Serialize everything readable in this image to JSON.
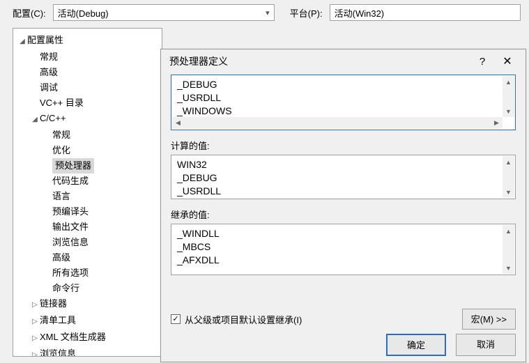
{
  "toolbar": {
    "config_label": "配置(C):",
    "config_value": "活动(Debug)",
    "platform_label": "平台(P):",
    "platform_value": "活动(Win32)"
  },
  "tree": {
    "root": "配置属性",
    "n_general": "常规",
    "n_advanced": "高级",
    "n_debug": "调试",
    "n_vcdir": "VC++ 目录",
    "n_cpp": "C/C++",
    "cpp_general": "常规",
    "cpp_opt": "优化",
    "cpp_preproc": "预处理器",
    "cpp_codegen": "代码生成",
    "cpp_lang": "语言",
    "cpp_pch": "预编译头",
    "cpp_out": "输出文件",
    "cpp_browse": "浏览信息",
    "cpp_adv": "高级",
    "cpp_all": "所有选项",
    "cpp_cmd": "命令行",
    "n_linker": "链接器",
    "n_manifest": "清单工具",
    "n_xml": "XML 文档生成器",
    "n_browse2": "浏览信息"
  },
  "dialog": {
    "title": "预处理器定义",
    "editbox": {
      "l1": "_DEBUG",
      "l2": "_USRDLL",
      "l3": "_WINDOWS"
    },
    "calc_label": "计算的值:",
    "calc": {
      "l1": "WIN32",
      "l2": "_DEBUG",
      "l3": "_USRDLL"
    },
    "inherit_label": "继承的值:",
    "inh": {
      "l1": "_WINDLL",
      "l2": "_MBCS",
      "l3": "_AFXDLL"
    },
    "inherit_chk": "从父级或项目默认设置继承(I)",
    "macro_btn": "宏(M) >>",
    "ok": "确定",
    "cancel": "取消"
  }
}
